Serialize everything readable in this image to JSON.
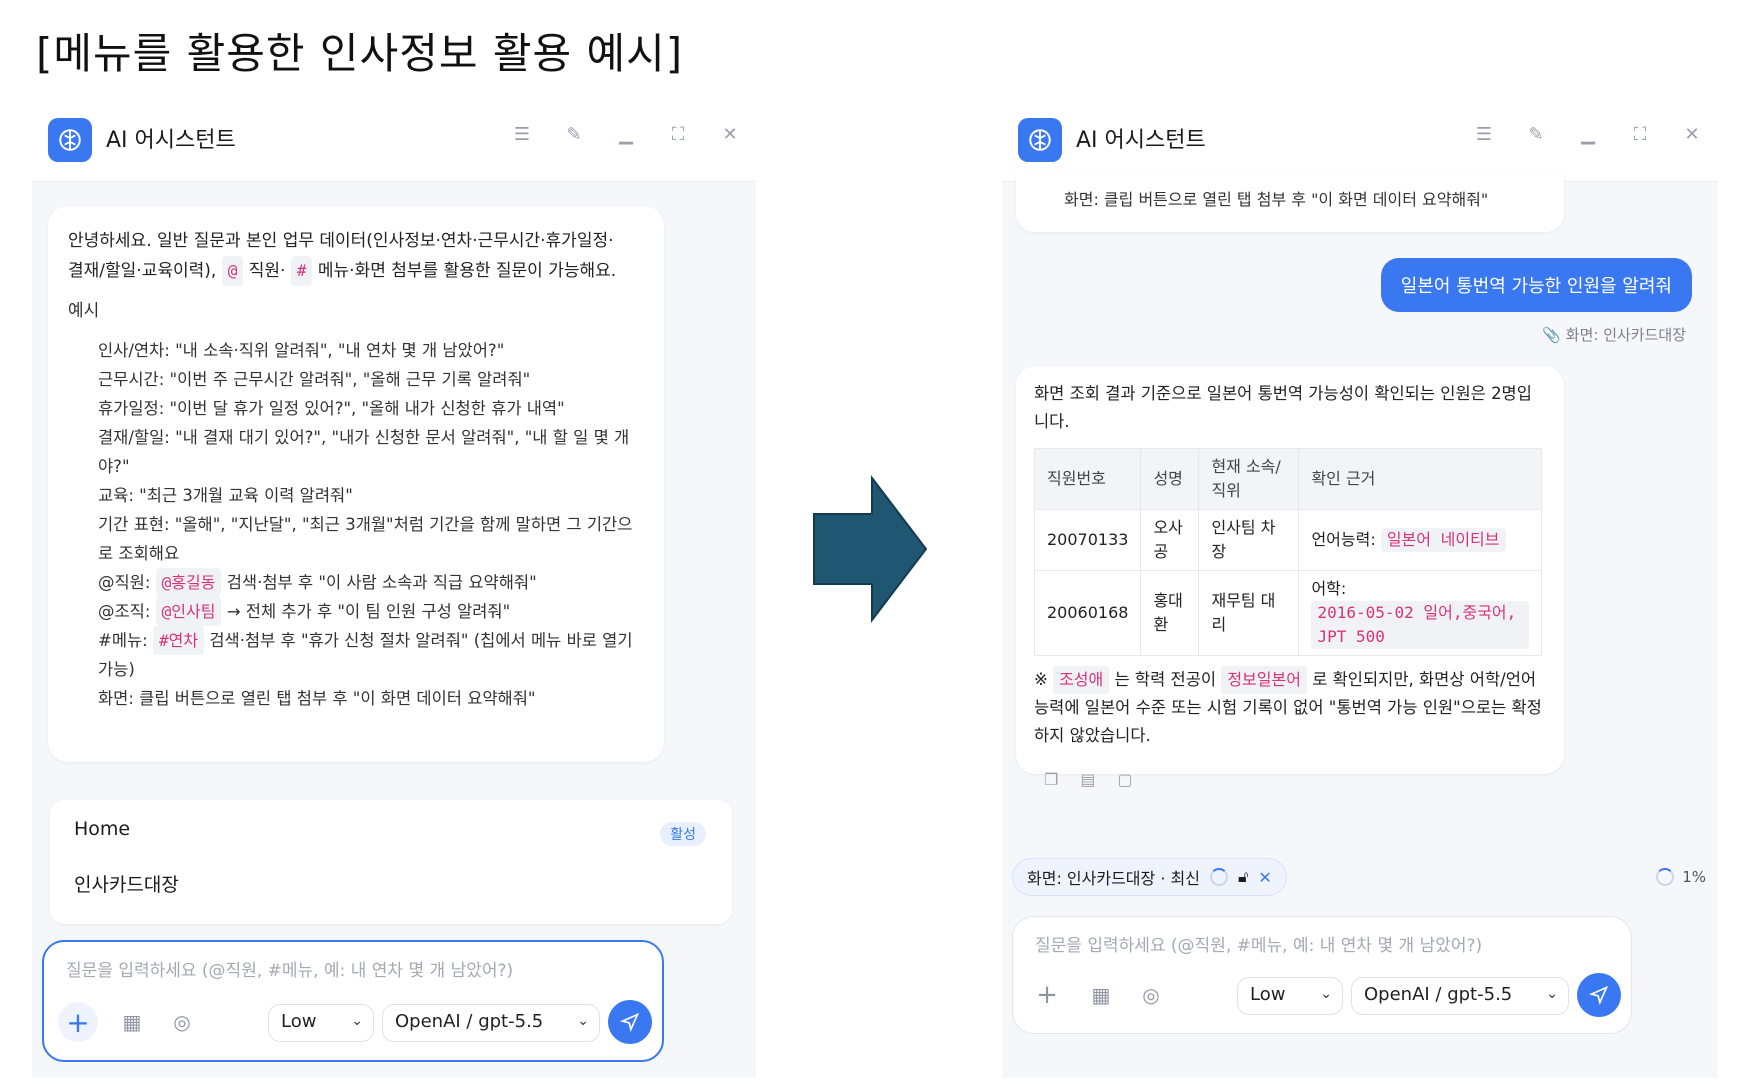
{
  "page_title": "[메뉴를 활용한 인사정보 활용 예시]",
  "left": {
    "header": {
      "title": "AI 어시스턴트"
    },
    "welcome": {
      "intro_1": "안녕하세요. 일반 질문과 본인 업무 데이터(인사정보·연차·근무시간·휴가일정·",
      "intro_2a": "결재/할일·교육이력),",
      "chip_at": "@",
      "intro_2b": "직원·",
      "chip_hash": "#",
      "intro_2c": "메뉴·화면 첨부를 활용한 질문이 가능해요.",
      "examples_title": "예시",
      "examples": [
        "인사/연차: \"내 소속·직위 알려줘\", \"내 연차 몇 개 남았어?\"",
        "근무시간: \"이번 주 근무시간 알려줘\", \"올해 근무 기록 알려줘\"",
        "휴가일정: \"이번 달 휴가 일정 있어?\", \"올해 내가 신청한 휴가 내역\"",
        "결재/할일: \"내 결재 대기 있어?\", \"내가 신청한 문서 알려줘\", \"내 할 일 몇 개 야?\"",
        "교육: \"최근 3개월 교육 이력 알려줘\"",
        "기간 표현: \"올해\", \"지난달\", \"최근 3개월\"처럼 기간을 함께 말하면 그 기간으로 조회해요"
      ],
      "ex_emp_prefix": "@직원:",
      "ex_emp_chip": "@홍길동",
      "ex_emp_suffix": "검색·첨부 후 \"이 사람 소속과 직급 요약해줘\"",
      "ex_org_prefix": "@조직:",
      "ex_org_chip": "@인사팀",
      "ex_org_suffix": "→ 전체 추가 후 \"이 팀 인원 구성 알려줘\"",
      "ex_menu_prefix": "#메뉴:",
      "ex_menu_chip": "#연차",
      "ex_menu_suffix": "검색·첨부 후 \"휴가 신청 절차 알려줘\" (칩에서 메뉴 바로 열기 가능)",
      "ex_screen": "화면: 클립 버튼으로 열린 탭 첨부 후 \"이 화면 데이터 요약해줘\""
    },
    "menu_popup": {
      "item_1": "Home",
      "badge": "활성",
      "item_2": "인사카드대장"
    },
    "input": {
      "placeholder": "질문을 입력하세요 (@직원, #메뉴, 예: 내 연차 몇 개 남았어?)",
      "effort": "Low",
      "model": "OpenAI / gpt-5.5"
    }
  },
  "right": {
    "header": {
      "title": "AI 어시스턴트"
    },
    "prev_message": "화면: 클립 버튼으로 열린 탭 첨부 후 \"이 화면 데이터 요약해줘\"",
    "user_message": "일본어 통번역 가능한 인원을 알려줘",
    "attachment_note": "화면: 인사카드대장",
    "answer": {
      "summary": "화면 조회 결과 기준으로 일본어 통번역 가능성이 확인되는 인원은 2명입니다.",
      "headers": [
        "직원번호",
        "성명",
        "현재 소속/직위",
        "확인 근거"
      ],
      "rows": [
        {
          "id": "20070133",
          "name": "오사공",
          "dept": "인사팀 차장",
          "basis_prefix": "언어능력:",
          "basis_chip": "일본어 네이티브"
        },
        {
          "id": "20060168",
          "name": "홍대환",
          "dept": "재무팀 대리",
          "basis_prefix": "어학:",
          "basis_chip": "2016-05-02 일어,중국어, JPT 500"
        }
      ],
      "note_prefix": "※",
      "note_chip_1": "조성애",
      "note_mid": "는 학력 전공이",
      "note_chip_2": "정보일본어",
      "note_suffix": "로 확인되지만, 화면상 어학/언어능력에 일본어 수준 또는 시험 기록이 없어 \"통번역 가능 인원\"으로는 확정하지 않았습니다."
    },
    "screen_chip": "화면: 인사카드대장 · 최신",
    "progress": "1%",
    "input": {
      "placeholder": "질문을 입력하세요 (@직원, #메뉴, 예: 내 연차 몇 개 남았어?)",
      "effort": "Low",
      "model": "OpenAI / gpt-5.5"
    }
  },
  "colors": {
    "accent": "#3a78f2",
    "chip_text": "#d6337a",
    "arrow": "#1f5671"
  }
}
